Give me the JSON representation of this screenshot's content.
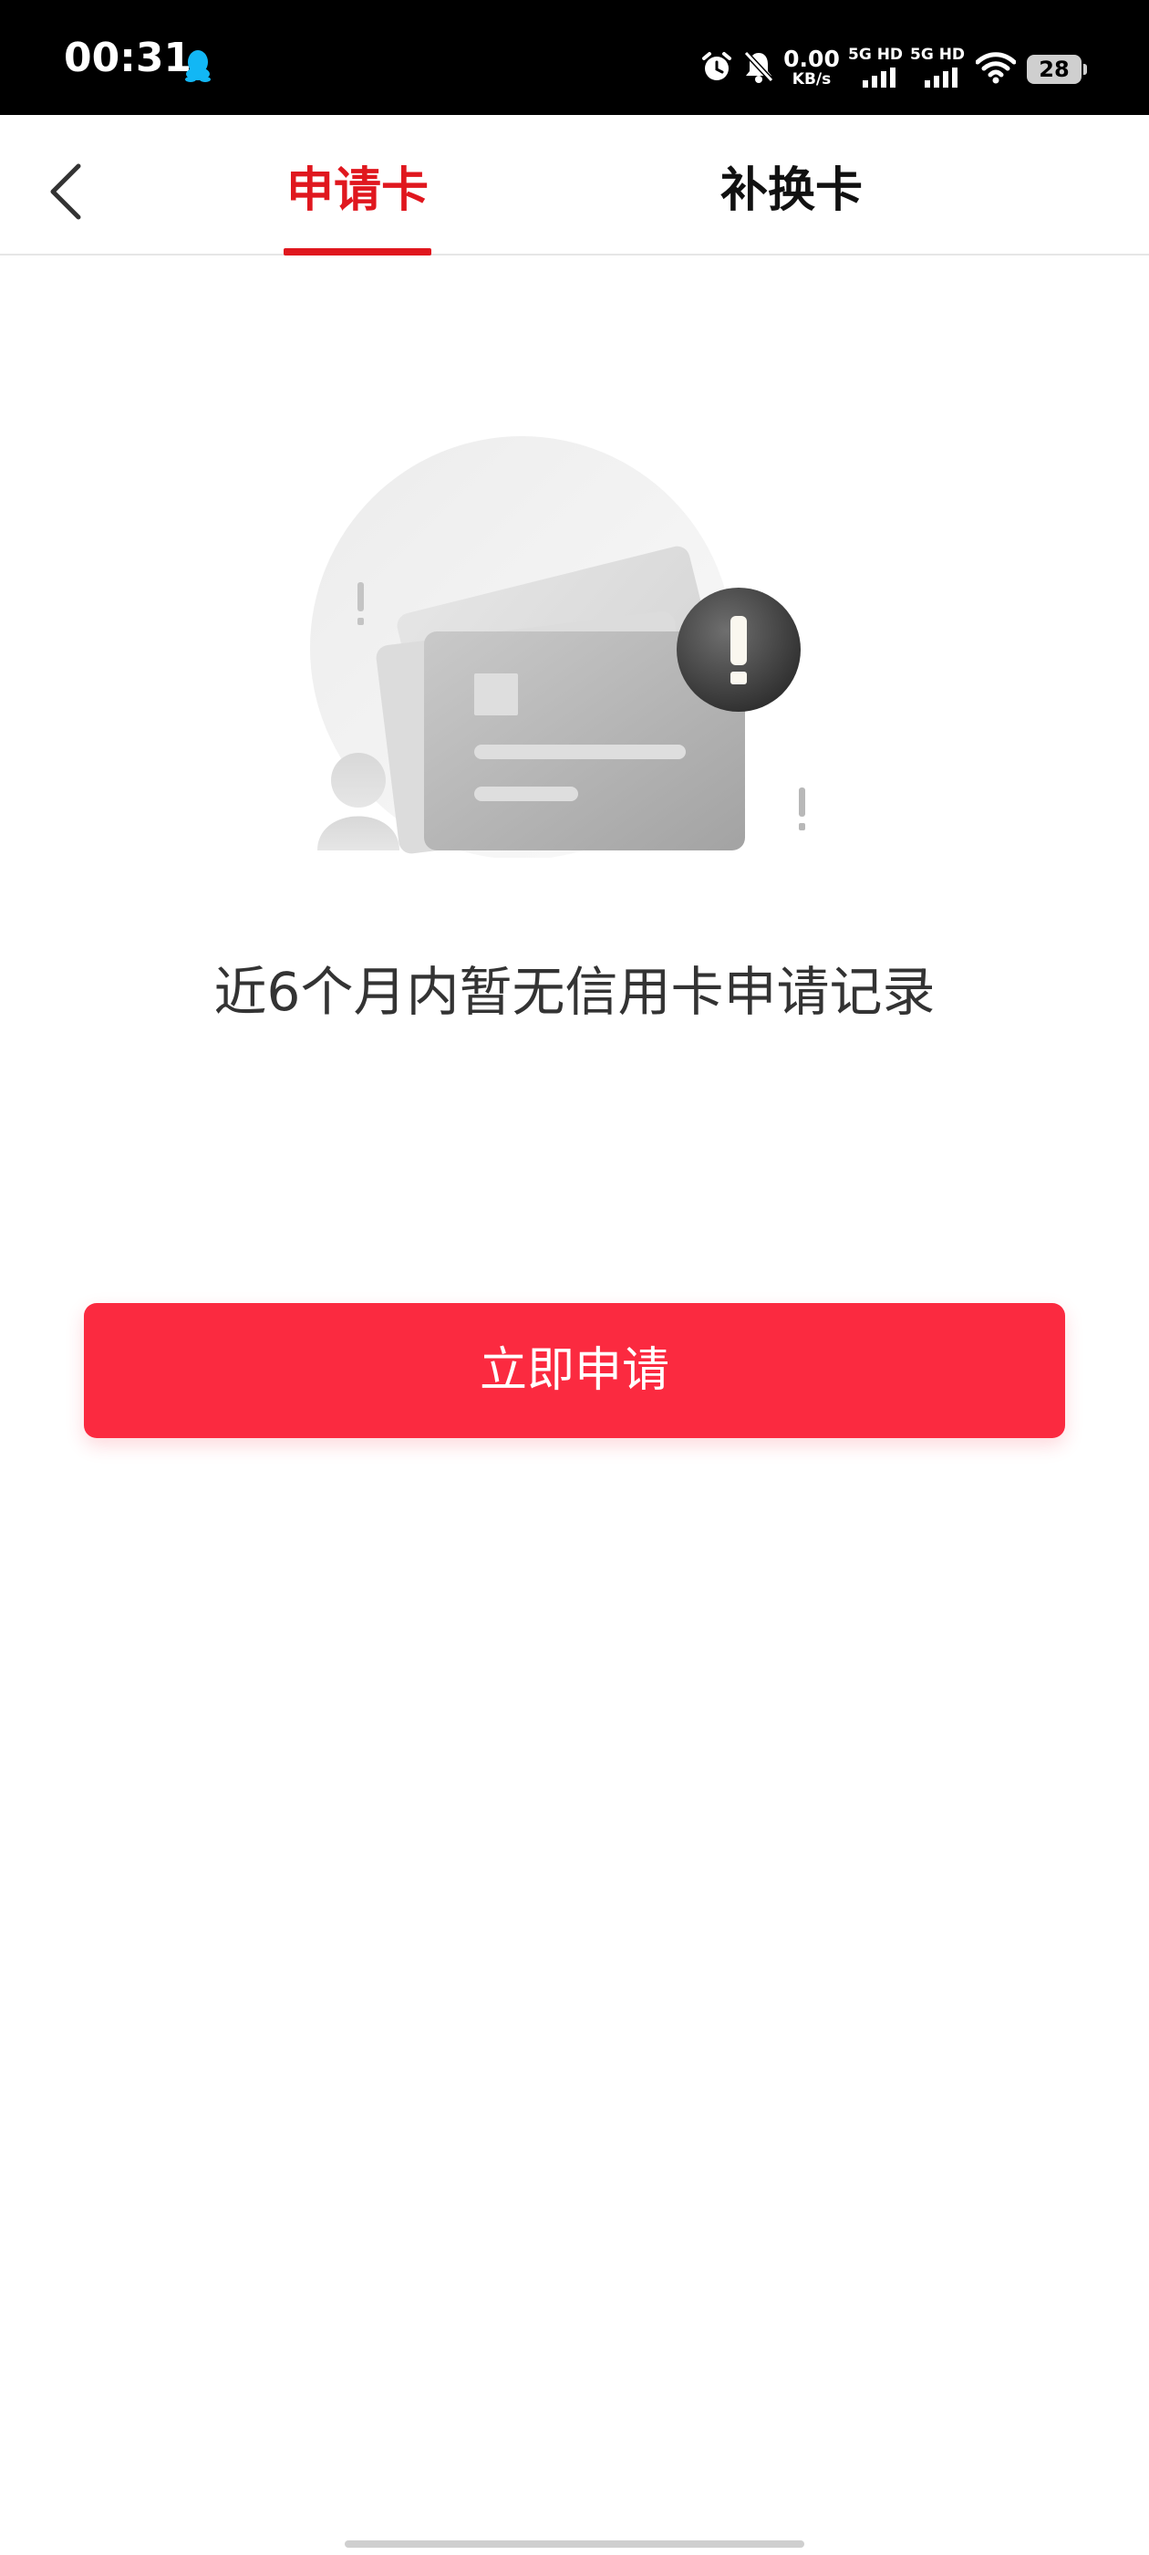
{
  "status_bar": {
    "time": "00:31",
    "net_speed_value": "0.00",
    "net_speed_unit": "KB/s",
    "sim1_label": "5G HD",
    "sim2_label": "5G HD",
    "battery": "28",
    "icons": [
      "qq-icon",
      "alarm-icon",
      "mute-bell-icon",
      "signal-icon",
      "wifi-icon",
      "battery-icon"
    ]
  },
  "header": {
    "back_icon": "chevron-left-icon",
    "tabs": [
      {
        "label": "申请卡",
        "active": true
      },
      {
        "label": "补换卡",
        "active": false
      }
    ]
  },
  "empty_state": {
    "illustration_icon": "credit-card-alert-icon",
    "message": "近6个月内暂无信用卡申请记录"
  },
  "actions": {
    "apply_label": "立即申请"
  },
  "colors": {
    "accent": "#e0171e",
    "button": "#fb2a40",
    "text": "#333333"
  }
}
